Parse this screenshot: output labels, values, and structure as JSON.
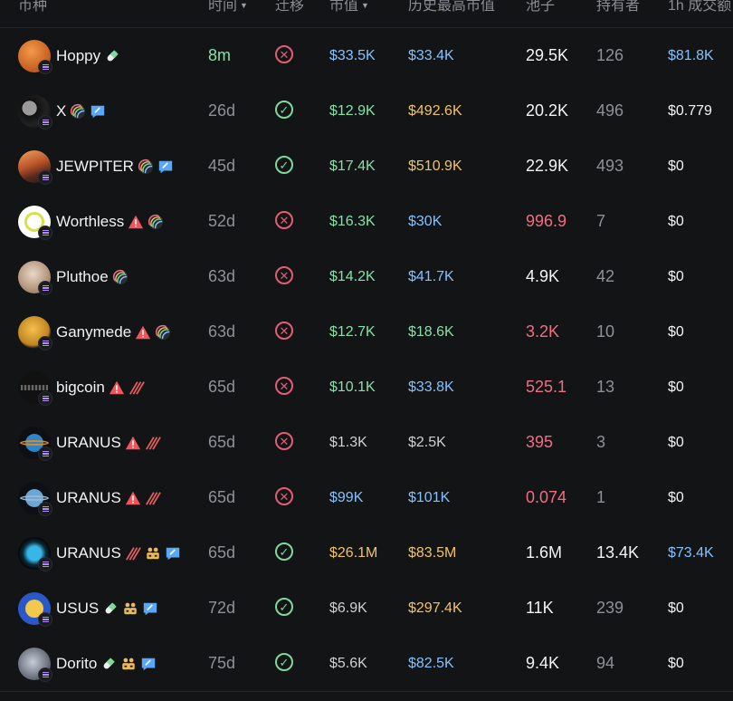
{
  "headers": {
    "coin": "币种",
    "time": "时间",
    "migrate": "迁移",
    "mcap": "市值",
    "ath": "历史最高市值",
    "pool": "池子",
    "holders": "持有者",
    "volume": "1h 成交额"
  },
  "rows": [
    {
      "name": "Hoppy",
      "time": "8m",
      "migrated": false,
      "mcap": "$33.5K",
      "ath": "$33.4K",
      "pool": "29.5K",
      "holders": "126",
      "volume": "$81.8K",
      "colors": {
        "time": "#86e0a6",
        "mcap": "#83c2ff",
        "ath": "#83c2ff",
        "pool": "#f4f4f4",
        "volume": "#83c2ff"
      },
      "badges": [
        "pill-icon"
      ]
    },
    {
      "name": "X",
      "time": "26d",
      "migrated": true,
      "mcap": "$12.9K",
      "ath": "$492.6K",
      "pool": "20.2K",
      "holders": "496",
      "volume": "$0.779",
      "colors": {
        "time": "#8e9197",
        "mcap": "#86e0a6",
        "ath": "#f2c366",
        "pool": "#f4f4f4",
        "volume": "#f4f4f4"
      },
      "badges": [
        "rainbow-icon",
        "chat-icon"
      ]
    },
    {
      "name": "JEWPITER",
      "time": "45d",
      "migrated": true,
      "mcap": "$17.4K",
      "ath": "$510.9K",
      "pool": "22.9K",
      "holders": "493",
      "volume": "$0",
      "colors": {
        "time": "#8e9197",
        "mcap": "#86e0a6",
        "ath": "#f2c366",
        "pool": "#f4f4f4",
        "volume": "#f4f4f4"
      },
      "badges": [
        "rainbow-icon",
        "chat-icon"
      ]
    },
    {
      "name": "Worthless",
      "time": "52d",
      "migrated": false,
      "mcap": "$16.3K",
      "ath": "$30K",
      "pool": "996.9",
      "holders": "7",
      "volume": "$0",
      "colors": {
        "time": "#8e9197",
        "mcap": "#86e0a6",
        "ath": "#83c2ff",
        "pool": "#f06e83",
        "volume": "#f4f4f4"
      },
      "badges": [
        "warning-icon",
        "rainbow-icon"
      ]
    },
    {
      "name": "Pluthoe",
      "time": "63d",
      "migrated": false,
      "mcap": "$14.2K",
      "ath": "$41.7K",
      "pool": "4.9K",
      "holders": "42",
      "volume": "$0",
      "colors": {
        "time": "#8e9197",
        "mcap": "#86e0a6",
        "ath": "#83c2ff",
        "pool": "#f4f4f4",
        "volume": "#f4f4f4"
      },
      "badges": [
        "rainbow-icon"
      ]
    },
    {
      "name": "Ganymede",
      "time": "63d",
      "migrated": false,
      "mcap": "$12.7K",
      "ath": "$18.6K",
      "pool": "3.2K",
      "holders": "10",
      "volume": "$0",
      "colors": {
        "time": "#8e9197",
        "mcap": "#86e0a6",
        "ath": "#86e0a6",
        "pool": "#f06e83",
        "volume": "#f4f4f4"
      },
      "badges": [
        "warning-icon",
        "rainbow-icon"
      ]
    },
    {
      "name": "bigcoin",
      "time": "65d",
      "migrated": false,
      "mcap": "$10.1K",
      "ath": "$33.8K",
      "pool": "525.1",
      "holders": "13",
      "volume": "$0",
      "colors": {
        "time": "#8e9197",
        "mcap": "#86e0a6",
        "ath": "#83c2ff",
        "pool": "#f06e83",
        "volume": "#f4f4f4"
      },
      "badges": [
        "warning-icon",
        "stripes-icon"
      ]
    },
    {
      "name": "URANUS",
      "time": "65d",
      "migrated": false,
      "mcap": "$1.3K",
      "ath": "$2.5K",
      "pool": "395",
      "holders": "3",
      "volume": "$0",
      "colors": {
        "time": "#8e9197",
        "mcap": "#d0d0d0",
        "ath": "#d0d0d0",
        "pool": "#f06e83",
        "volume": "#f4f4f4"
      },
      "badges": [
        "warning-icon",
        "stripes-icon"
      ]
    },
    {
      "name": "URANUS",
      "time": "65d",
      "migrated": false,
      "mcap": "$99K",
      "ath": "$101K",
      "pool": "0.074",
      "holders": "1",
      "volume": "$0",
      "colors": {
        "time": "#8e9197",
        "mcap": "#83c2ff",
        "ath": "#83c2ff",
        "pool": "#f06e83",
        "volume": "#f4f4f4"
      },
      "badges": [
        "warning-icon",
        "stripes-icon"
      ]
    },
    {
      "name": "URANUS",
      "time": "65d",
      "migrated": true,
      "mcap": "$26.1M",
      "ath": "$83.5M",
      "pool": "1.6M",
      "holders": "13.4K",
      "volume": "$73.4K",
      "colors": {
        "time": "#8e9197",
        "mcap": "#f2c366",
        "ath": "#f2c366",
        "pool": "#f4f4f4",
        "volume": "#83c2ff",
        "holders": "#f4f4f4"
      },
      "badges": [
        "stripes-icon",
        "people-icon",
        "chat-icon"
      ]
    },
    {
      "name": "USUS",
      "time": "72d",
      "migrated": true,
      "mcap": "$6.9K",
      "ath": "$297.4K",
      "pool": "11K",
      "holders": "239",
      "volume": "$0",
      "colors": {
        "time": "#8e9197",
        "mcap": "#d0d0d0",
        "ath": "#f2c366",
        "pool": "#f4f4f4",
        "volume": "#f4f4f4"
      },
      "badges": [
        "pill-icon",
        "people-icon",
        "chat-icon"
      ]
    },
    {
      "name": "Dorito",
      "time": "75d",
      "migrated": true,
      "mcap": "$5.6K",
      "ath": "$82.5K",
      "pool": "9.4K",
      "holders": "94",
      "volume": "$0",
      "colors": {
        "time": "#8e9197",
        "mcap": "#d0d0d0",
        "ath": "#83c2ff",
        "pool": "#f4f4f4",
        "volume": "#f4f4f4"
      },
      "badges": [
        "pill-icon",
        "people-icon",
        "chat-icon"
      ]
    }
  ]
}
